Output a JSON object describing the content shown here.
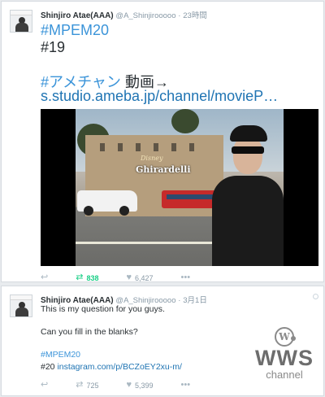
{
  "tweet1": {
    "name": "Shinjiro Atae(AAA)",
    "handle": "@A_Shinjirooooo",
    "separator": "·",
    "time": "23時間",
    "hashtag": "#MPEM20",
    "line2": "#19",
    "hashtag2": "#アメチャン",
    "line3_text": " 動画→",
    "link": "s.studio.ameba.jp/channel/movieP…",
    "media_sign": "Ghirardelli",
    "media_sign_top": "Disney",
    "actions": {
      "reply_icon": "reply-icon",
      "retweet_icon": "retweet-icon",
      "retweet_count": "838",
      "like_icon": "heart-icon",
      "like_count": "6,427",
      "more_icon": "more-icon"
    }
  },
  "tweet2": {
    "name": "Shinjiro Atae(AAA)",
    "handle": "@A_Shinjirooooo",
    "separator": "·",
    "time": "3月1日",
    "text1": "This is my question for you guys.",
    "text2": "Can you fill in the blanks?",
    "hashtag": "#MPEM20",
    "text4_prefix": "#20 ",
    "link": "instagram.com/p/BCZoEY2xu-m/",
    "actions": {
      "retweet_count": "725",
      "like_count": "5,399"
    }
  },
  "watermark": {
    "badge": "W",
    "brand": "WWS",
    "sub": "channel"
  },
  "colors": {
    "link": "#3b94d9",
    "retweet_active": "#19cf86",
    "meta": "#8899a6"
  }
}
